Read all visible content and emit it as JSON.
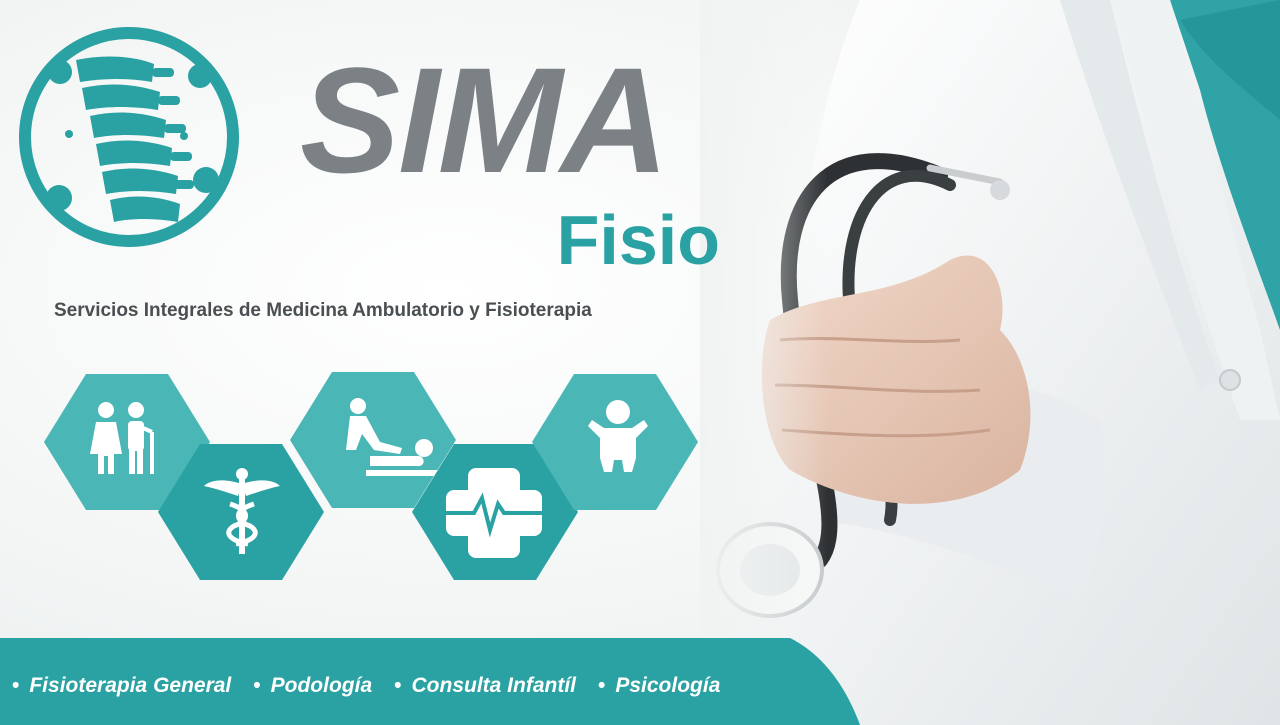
{
  "brand": {
    "title": "SIMA",
    "subtitle": "Fisio",
    "tagline": "Servicios Integrales de Medicina Ambulatorio y Fisioterapia"
  },
  "colors": {
    "teal": "#2aa1a2",
    "teal_light": "#4bb6b6",
    "gray_title": "#7b8184",
    "gray_text": "#4a4f52"
  },
  "icons": [
    "spine-logo-icon",
    "elderly-couple-icon",
    "caduceus-icon",
    "massage-icon",
    "medical-cross-heartbeat-icon",
    "baby-icon",
    "doctor-stethoscope-photo"
  ],
  "services": [
    "Fisioterapia General",
    "Podología",
    "Consulta Infantíl",
    "Psicología"
  ]
}
